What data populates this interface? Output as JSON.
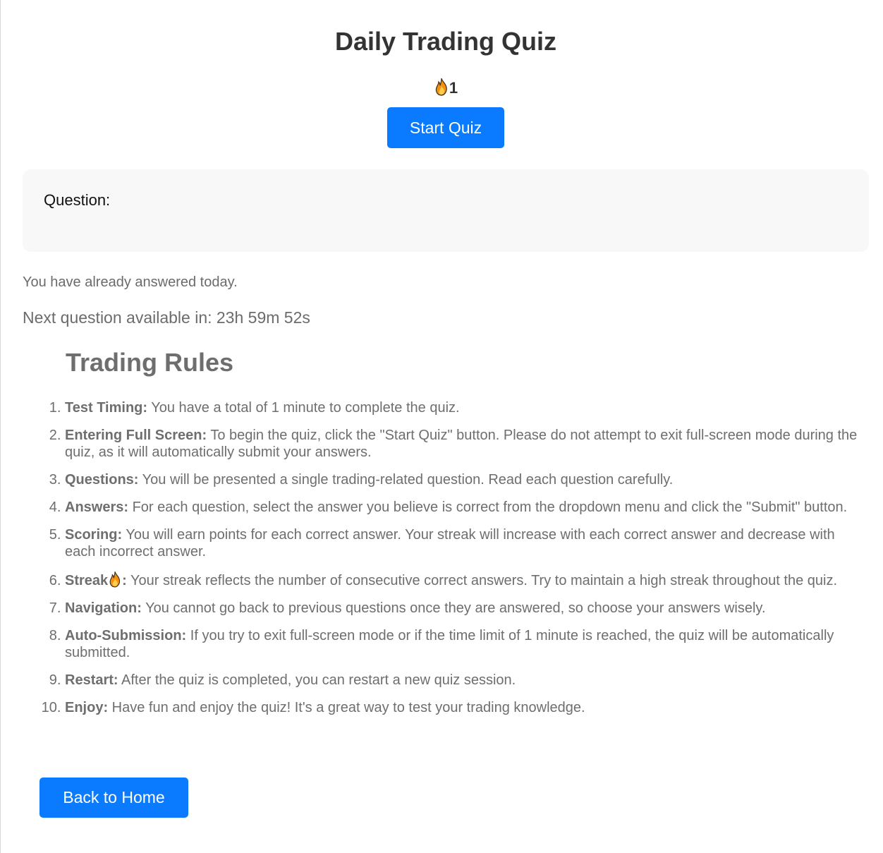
{
  "header": {
    "title": "Daily Trading Quiz",
    "streak_icon": "fire-icon",
    "streak_count": "1",
    "start_button": "Start Quiz"
  },
  "question": {
    "label": "Question:"
  },
  "status": {
    "answered_message": "You have already answered today.",
    "countdown_prefix": "Next question available in:",
    "countdown_value": "23h 59m 52s"
  },
  "rules": {
    "title": "Trading Rules",
    "items": [
      {
        "term": "Test Timing:",
        "text": " You have a total of 1 minute to complete the quiz."
      },
      {
        "term": "Entering Full Screen:",
        "text": " To begin the quiz, click the \"Start Quiz\" button. Please do not attempt to exit full-screen mode during the quiz, as it will automatically submit your answers."
      },
      {
        "term": "Questions:",
        "text": " You will be presented a single trading-related question. Read each question carefully."
      },
      {
        "term": "Answers:",
        "text": " For each question, select the answer you believe is correct from the dropdown menu and click the \"Submit\" button."
      },
      {
        "term": "Scoring:",
        "text": " You will earn points for each correct answer. Your streak will increase with each correct answer and decrease with each incorrect answer."
      },
      {
        "term": "Streak",
        "term_suffix": ":",
        "text": " Your streak reflects the number of consecutive correct answers. Try to maintain a high streak throughout the quiz."
      },
      {
        "term": "Navigation:",
        "text": " You cannot go back to previous questions once they are answered, so choose your answers wisely."
      },
      {
        "term": "Auto-Submission:",
        "text": " If you try to exit full-screen mode or if the time limit of 1 minute is reached, the quiz will be automatically submitted."
      },
      {
        "term": "Restart:",
        "text": " After the quiz is completed, you can restart a new quiz session."
      },
      {
        "term": "Enjoy:",
        "text": " Have fun and enjoy the quiz! It's a great way to test your trading knowledge."
      }
    ]
  },
  "footer": {
    "back_button": "Back to Home"
  },
  "colors": {
    "primary_button": "#0a7bff",
    "title_text": "#333333",
    "muted_text": "#6e6e6e",
    "panel_background": "#f8f8f8"
  }
}
